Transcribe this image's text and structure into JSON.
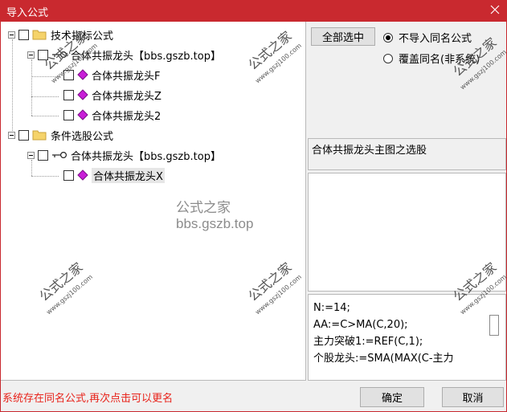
{
  "window": {
    "title": "导入公式",
    "close_icon": "close-icon"
  },
  "tree": {
    "groups": [
      {
        "label": "技术指标公式",
        "children": [
          {
            "label": "合体共振龙头【bbs.gszb.top】",
            "icon": "key-icon",
            "children": [
              {
                "label": "合体共振龙头F",
                "icon": "diamond-icon"
              },
              {
                "label": "合体共振龙头Z",
                "icon": "diamond-icon"
              },
              {
                "label": "合体共振龙头2",
                "icon": "diamond-icon"
              }
            ]
          }
        ]
      },
      {
        "label": "条件选股公式",
        "children": [
          {
            "label": "合体共振龙头【bbs.gszb.top】",
            "icon": "key-icon",
            "children": [
              {
                "label": "合体共振龙头X",
                "icon": "diamond-icon",
                "selected": true
              }
            ]
          }
        ]
      }
    ]
  },
  "watermark": {
    "center_text": "公式之家 bbs.gszb.top",
    "stamp_text": "公式之家",
    "stamp_url": "www.gszj100.com"
  },
  "options": {
    "select_all_label": "全部选中",
    "radio_no_import": "不导入同名公式",
    "radio_overwrite": "覆盖同名(非系统)",
    "selected_radio": "radio_no_import"
  },
  "description": "合体共振龙头主图之选股",
  "code_lines": [
    "N:=14;",
    "AA:=C>MA(C,20);",
    "主力突破1:=REF(C,1);",
    "个股龙头:=SMA(MAX(C-主力"
  ],
  "status": {
    "message": "系统存在同名公式,再次点击可以更名",
    "color": "#e8231b"
  },
  "buttons": {
    "ok": "确定",
    "cancel": "取消"
  },
  "colors": {
    "titlebar": "#c9292f",
    "diamond": "#c81fd8"
  }
}
